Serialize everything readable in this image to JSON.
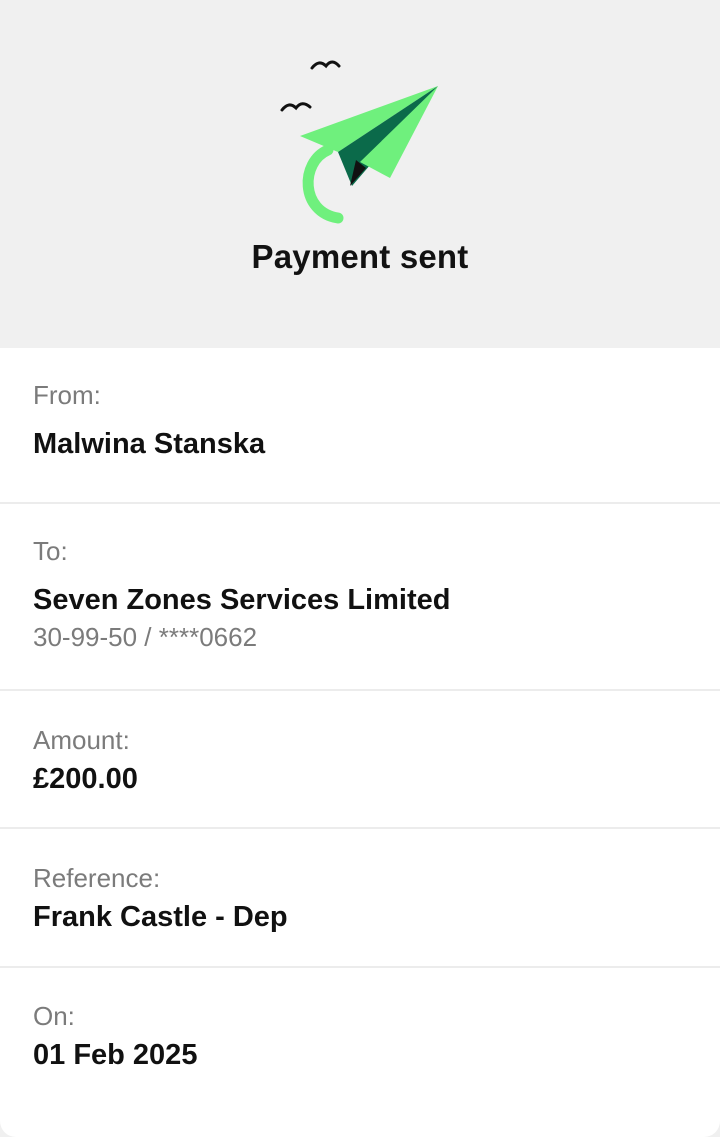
{
  "header": {
    "title": "Payment sent",
    "illustration_icon": "paper-plane-icon"
  },
  "details": {
    "from": {
      "label": "From:",
      "value": "Malwina Stanska"
    },
    "to": {
      "label": "To:",
      "value": "Seven Zones Services Limited",
      "account": "30-99-50 / ****0662"
    },
    "amount": {
      "label": "Amount:",
      "value": "£200.00"
    },
    "reference": {
      "label": "Reference:",
      "value": "Frank Castle - Dep"
    },
    "on": {
      "label": "On:",
      "value": "01 Feb 2025"
    }
  },
  "colors": {
    "plane_light": "#6ff07d",
    "plane_dark": "#0b6a4a",
    "trail": "#6ff07d",
    "background": "#f0f0f0",
    "card": "#ffffff"
  }
}
